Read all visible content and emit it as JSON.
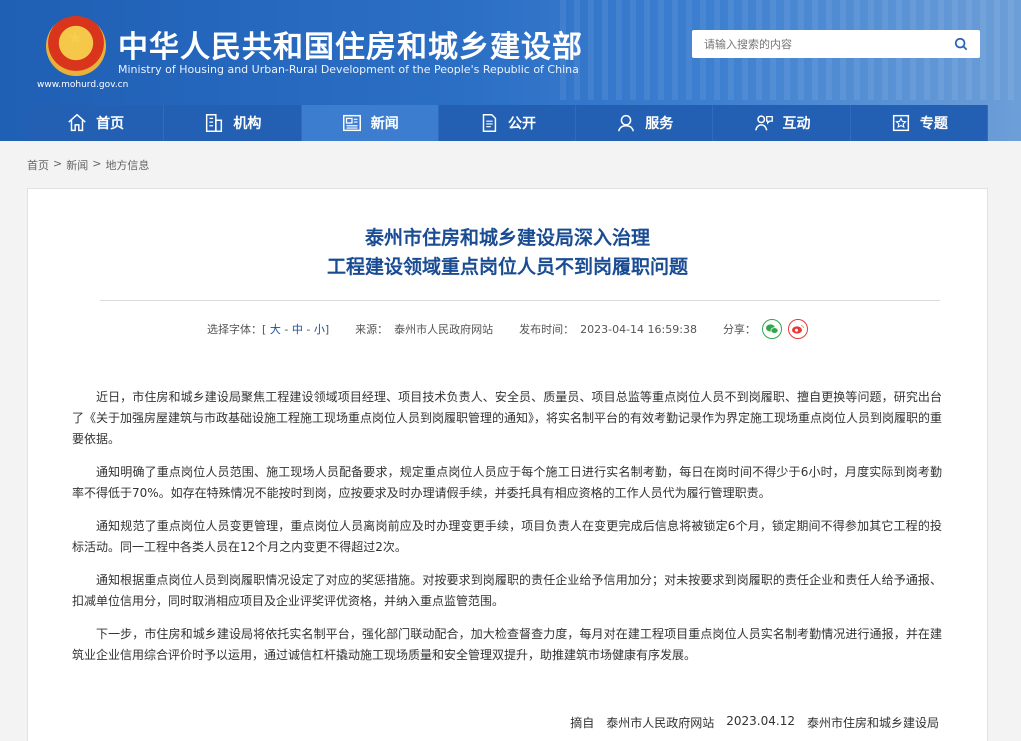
{
  "header": {
    "title": "中华人民共和国住房和城乡建设部",
    "subtitle": "Ministry of Housing and Urban-Rural Development of the People's Republic of China",
    "url": "www.mohurd.gov.cn",
    "search_placeholder": "请输入搜索的内容"
  },
  "nav": [
    {
      "label": "首页",
      "icon": "home-icon"
    },
    {
      "label": "机构",
      "icon": "building-icon"
    },
    {
      "label": "新闻",
      "icon": "newspaper-icon"
    },
    {
      "label": "公开",
      "icon": "document-icon"
    },
    {
      "label": "服务",
      "icon": "service-icon"
    },
    {
      "label": "互动",
      "icon": "interaction-icon"
    },
    {
      "label": "专题",
      "icon": "topic-icon"
    }
  ],
  "breadcrumb": [
    "首页",
    ">",
    "新闻",
    ">",
    "地方信息"
  ],
  "article": {
    "title_line1": "泰州市住房和城乡建设局深入治理",
    "title_line2": "工程建设领域重点岗位人员不到岗履职问题",
    "font_label": "选择字体：",
    "font_open": "[",
    "font_large": "大",
    "font_medium": "中",
    "font_small": "小",
    "font_sep": "-",
    "font_close": "]",
    "source_label": "来源：",
    "source_value": "泰州市人民政府网站",
    "time_label": "发布时间：",
    "time_value": "2023-04-14 16:59:38",
    "share_label": "分享：",
    "paragraphs": [
      "近日，市住房和城乡建设局聚焦工程建设领域项目经理、项目技术负责人、安全员、质量员、项目总监等重点岗位人员不到岗履职、擅自更换等问题，研究出台了《关于加强房屋建筑与市政基础设施工程施工现场重点岗位人员到岗履职管理的通知》，将实名制平台的有效考勤记录作为界定施工现场重点岗位人员到岗履职的重要依据。",
      "通知明确了重点岗位人员范围、施工现场人员配备要求，规定重点岗位人员应于每个施工日进行实名制考勤，每日在岗时间不得少于6小时，月度实际到岗考勤率不得低于70%。如存在特殊情况不能按时到岗，应按要求及时办理请假手续，并委托具有相应资格的工作人员代为履行管理职责。",
      "通知规范了重点岗位人员变更管理，重点岗位人员离岗前应及时办理变更手续，项目负责人在变更完成后信息将被锁定6个月，锁定期间不得参加其它工程的投标活动。同一工程中各类人员在12个月之内变更不得超过2次。",
      "通知根据重点岗位人员到岗履职情况设定了对应的奖惩措施。对按要求到岗履职的责任企业给予信用加分；对未按要求到岗履职的责任企业和责任人给予通报、扣减单位信用分，同时取消相应项目及企业评奖评优资格，并纳入重点监管范围。",
      "下一步，市住房和城乡建设局将依托实名制平台，强化部门联动配合，加大检查督查力度，每月对在建工程项目重点岗位人员实名制考勤情况进行通报，并在建筑业企业信用综合评价时予以运用，通过诚信杠杆撬动施工现场质量和安全管理双提升，助推建筑市场健康有序发展。"
    ],
    "footer": {
      "prefix": "摘自",
      "site": "泰州市人民政府网站",
      "date": "2023.04.12",
      "org": "泰州市住房和城乡建设局"
    }
  },
  "colors": {
    "header_blue": "#2360b3",
    "nav_active": "#3d7dd0",
    "title_blue": "#1a4c94",
    "wechat_green": "#2ea84b",
    "weibo_red": "#e6393a"
  }
}
